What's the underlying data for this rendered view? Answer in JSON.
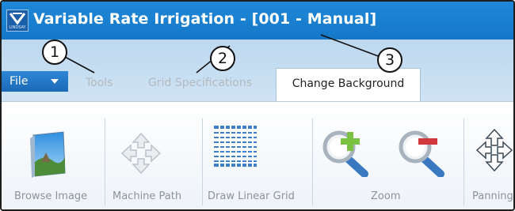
{
  "window": {
    "title": "Variable Rate Irrigation - [001 - Manual]",
    "logo_text": "LINDSAY"
  },
  "ribbon": {
    "file_label": "File",
    "tabs": [
      {
        "label": "Tools",
        "active": false
      },
      {
        "label": "Grid Specifications",
        "active": false
      },
      {
        "label": "Change Background",
        "active": true
      }
    ]
  },
  "groups": {
    "browse_image": "Browse Image",
    "machine_path": "Machine Path",
    "draw_linear_grid": "Draw Linear Grid",
    "zoom": "Zoom",
    "panning": "Panning"
  },
  "icons": {
    "browse_image": "browse-image-icon",
    "machine_path": "machine-path-icon",
    "draw_linear_grid": "grid-icon",
    "zoom_in": "zoom-in-icon",
    "zoom_out": "zoom-out-icon",
    "panning": "panning-icon"
  },
  "callouts": [
    "1",
    "2",
    "3"
  ],
  "colors": {
    "titlebar": "#1677c7",
    "file_button": "#1b69b6",
    "ribbon": "#cfe3f4",
    "zoom_in_plus": "#7cc242",
    "zoom_out_minus": "#d0383d"
  }
}
